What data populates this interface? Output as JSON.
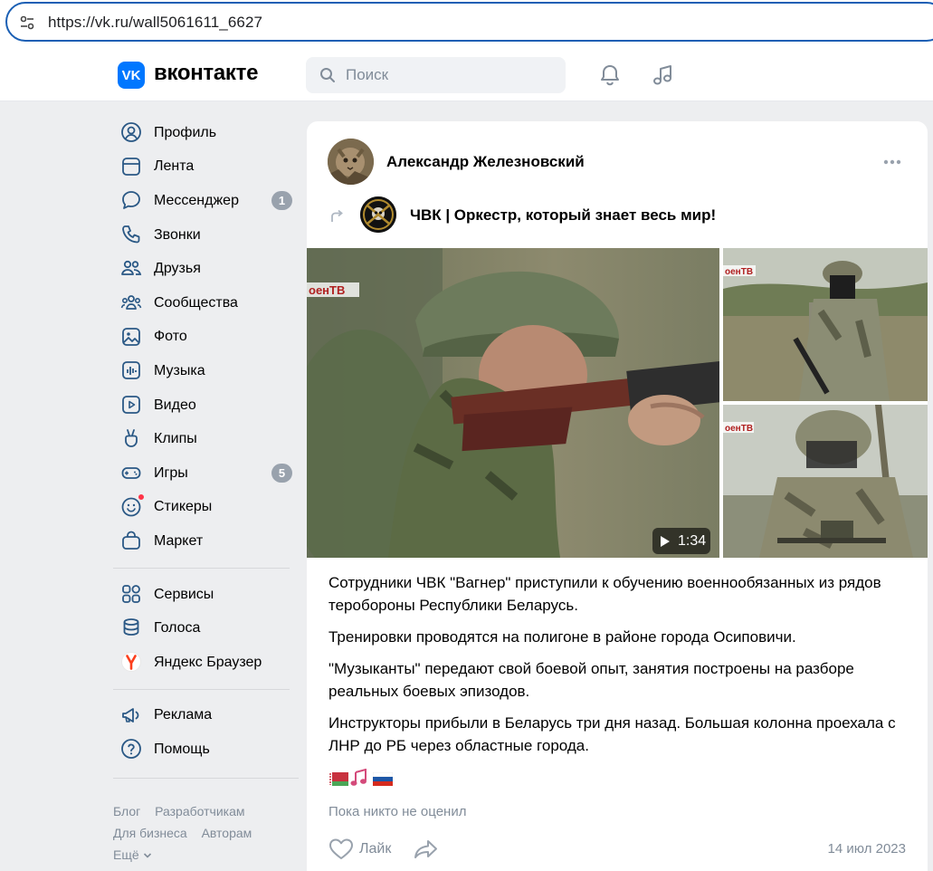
{
  "browser": {
    "url": "https://vk.ru/wall5061611_6627"
  },
  "header": {
    "logo_text": "VK",
    "brand": "вконтакте",
    "search_placeholder": "Поиск"
  },
  "sidebar": {
    "items": [
      {
        "label": "Профиль",
        "icon": "profile-icon"
      },
      {
        "label": "Лента",
        "icon": "feed-icon"
      },
      {
        "label": "Мессенджер",
        "icon": "messenger-icon",
        "badge": "1"
      },
      {
        "label": "Звонки",
        "icon": "phone-icon"
      },
      {
        "label": "Друзья",
        "icon": "friends-icon"
      },
      {
        "label": "Сообщества",
        "icon": "communities-icon"
      },
      {
        "label": "Фото",
        "icon": "photo-icon"
      },
      {
        "label": "Музыка",
        "icon": "music-icon"
      },
      {
        "label": "Видео",
        "icon": "video-icon"
      },
      {
        "label": "Клипы",
        "icon": "clips-icon"
      },
      {
        "label": "Игры",
        "icon": "games-icon",
        "badge": "5"
      },
      {
        "label": "Стикеры",
        "icon": "stickers-icon"
      },
      {
        "label": "Маркет",
        "icon": "market-icon"
      }
    ],
    "items2": [
      {
        "label": "Сервисы",
        "icon": "services-icon"
      },
      {
        "label": "Голоса",
        "icon": "votes-icon"
      },
      {
        "label": "Яндекс Браузер",
        "icon": "yandex-browser-icon"
      }
    ],
    "items3": [
      {
        "label": "Реклама",
        "icon": "ads-icon"
      },
      {
        "label": "Помощь",
        "icon": "help-icon"
      }
    ],
    "footer": {
      "blog": "Блог",
      "developers": "Разработчикам",
      "business": "Для бизнеса",
      "authors": "Авторам",
      "more": "Ещё"
    }
  },
  "post": {
    "author": "Александр Железновский",
    "repost_source": "ЧВК | Оркестр, который знает весь мир!",
    "video_duration": "1:34",
    "paragraphs": [
      "Сотрудники ЧВК \"Вагнер\" приступили к обучению военнообязанных из рядов теробороны Республики Беларусь.",
      "Тренировки проводятся на полигоне в районе города Осиповичи.",
      "\"Музыканты\" передают свой боевой опыт, занятия построены на разборе реальных боевых эпизодов.",
      "Инструкторы прибыли в Беларусь три дня назад. Большая колонна проехала с ЛНР до РБ через областные города."
    ],
    "emojis": [
      "belarus-flag",
      "musical-notes",
      "russia-flag"
    ],
    "likes_note": "Пока никто не оценил",
    "like_label": "Лайк",
    "date": "14 июл 2023",
    "watermark": "оенТВ"
  },
  "colors": {
    "accent": "#0077ff",
    "bg": "#edeef0",
    "secondary_text": "#818c99",
    "badge": "#99a2ad",
    "url_border": "#1a5fb4"
  }
}
